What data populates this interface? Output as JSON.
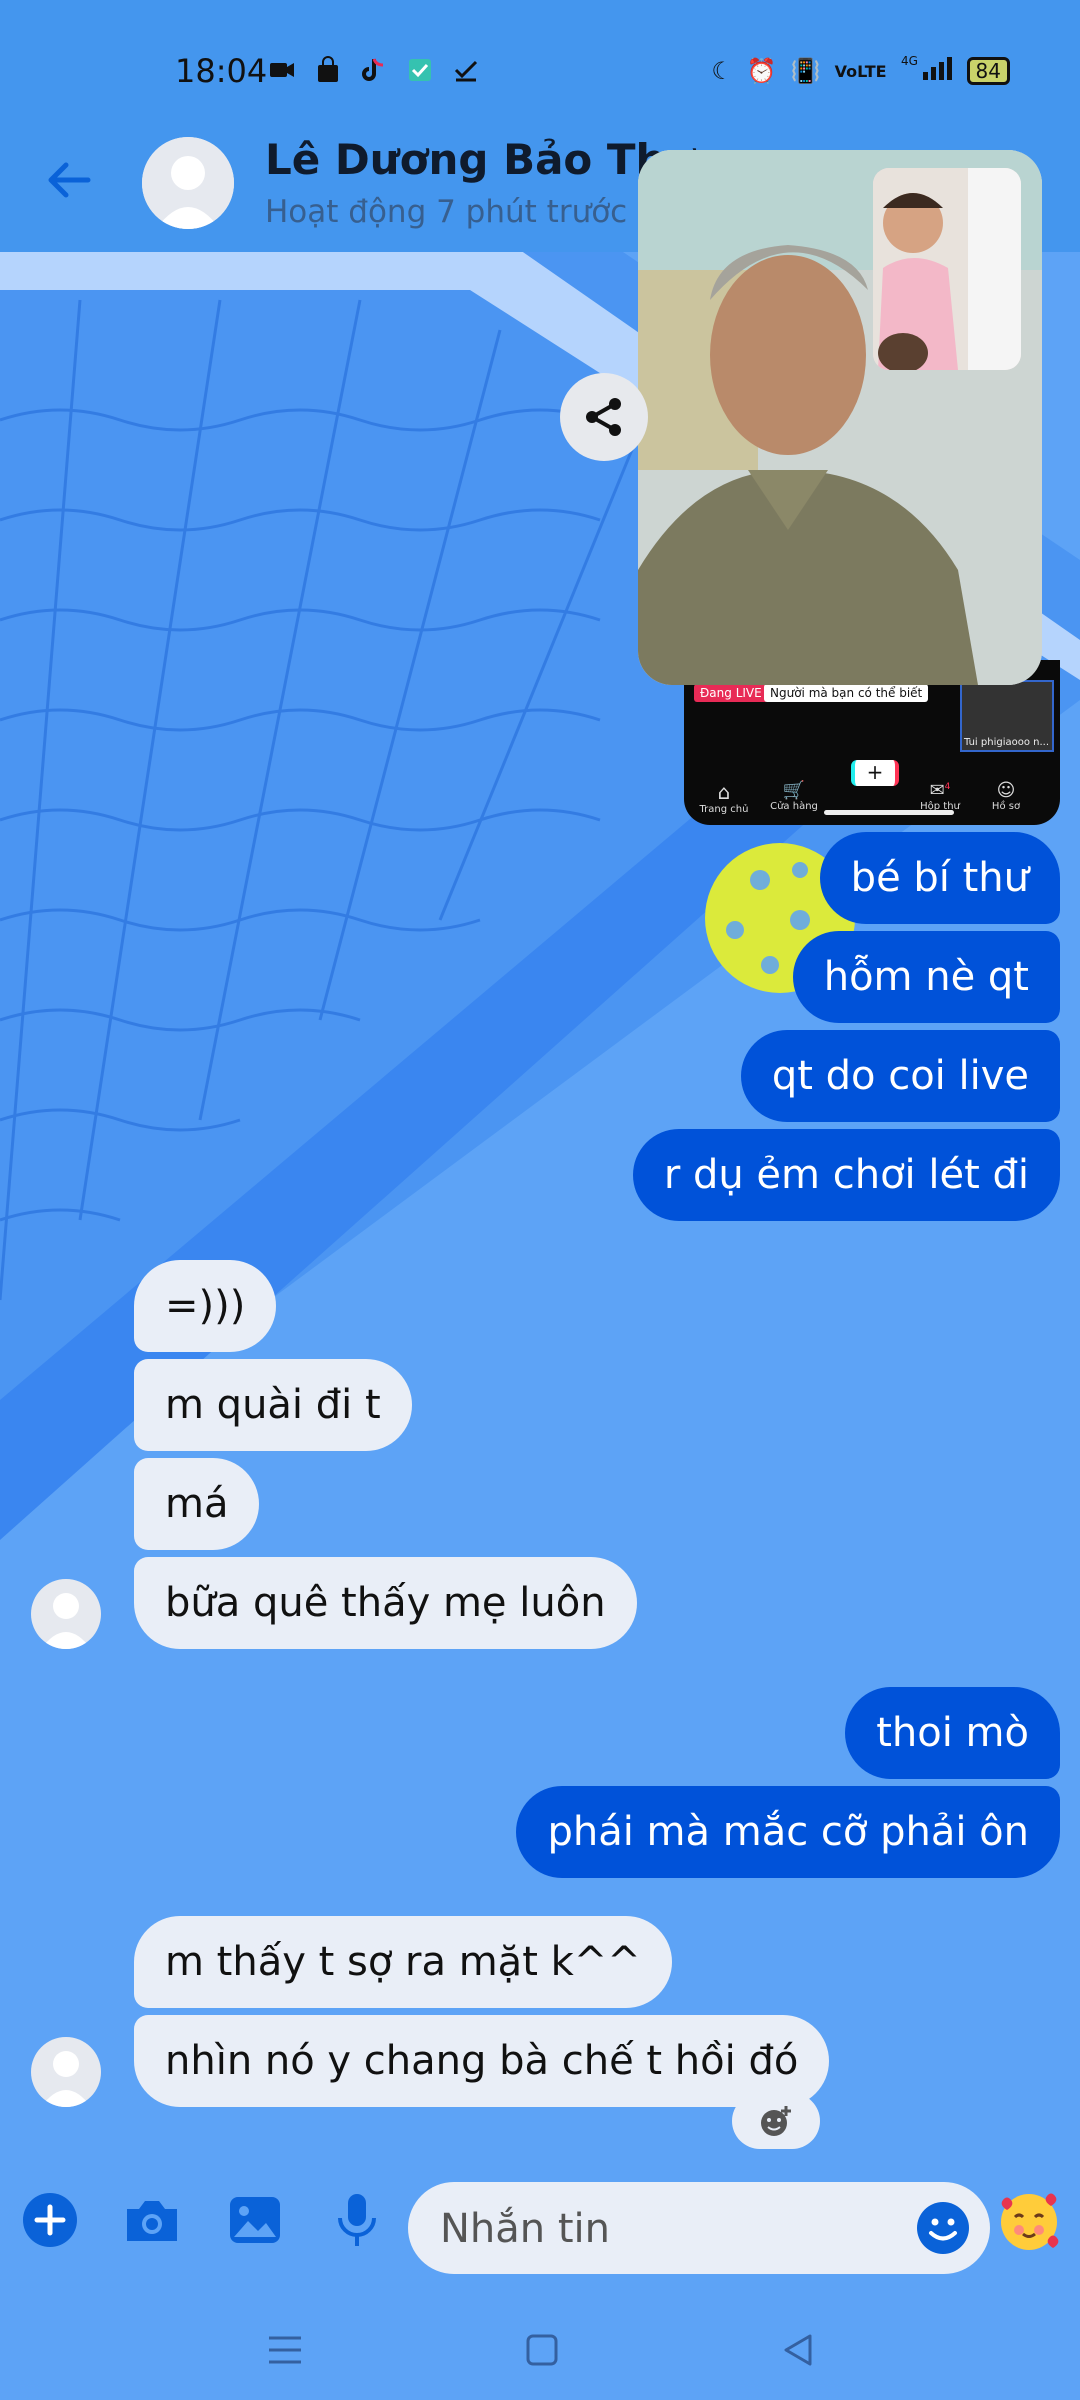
{
  "status_bar": {
    "time": "18:04",
    "battery": "84",
    "network": "4G"
  },
  "header": {
    "contact_name": "Lê Dương Bảo Thư",
    "activity": "Hoạt động 7 phút trước"
  },
  "shared_video": {
    "live_badge": "Đang LIVE",
    "live_caption": "Người mà bạn có thể biết",
    "profile_caption": "Tui phigiaooo n...",
    "tabs": [
      "Trang chủ",
      "Cửa hàng",
      "",
      "Hộp thư",
      "Hồ sơ"
    ],
    "inbox_count": "4"
  },
  "messages": [
    {
      "text": "bé bí thư",
      "direction": "out"
    },
    {
      "text": "hỗm nè qt",
      "direction": "out"
    },
    {
      "text": "qt do coi live",
      "direction": "out"
    },
    {
      "text": "r dụ ẻm chơi lét đi",
      "direction": "out"
    },
    {
      "text": "=)))",
      "direction": "in"
    },
    {
      "text": "m quài đi t",
      "direction": "in"
    },
    {
      "text": "má",
      "direction": "in"
    },
    {
      "text": "bữa quê thấy mẹ luôn",
      "direction": "in"
    },
    {
      "text": "thoi mò",
      "direction": "out"
    },
    {
      "text": "phái mà mắc cỡ phải ôn",
      "direction": "out"
    },
    {
      "text": "m thấy t sợ ra mặt k^^",
      "direction": "in"
    },
    {
      "text": "nhìn nó y chang bà chế t hồi đó",
      "direction": "in"
    }
  ],
  "composer": {
    "placeholder": "Nhắn tin"
  },
  "icons": {
    "back": "arrow-left-icon",
    "share": "share-icon",
    "plus": "plus-icon",
    "camera": "camera-icon",
    "gallery": "image-icon",
    "mic": "microphone-icon",
    "emoji": "smiley-icon",
    "sticker": "emoji-face-icon",
    "react": "add-reaction-icon"
  },
  "colors": {
    "outgoing_bubble": "#0052d9",
    "incoming_bubble": "#e9eef7",
    "accent": "#1a73e8",
    "background": "#5da3f6"
  }
}
